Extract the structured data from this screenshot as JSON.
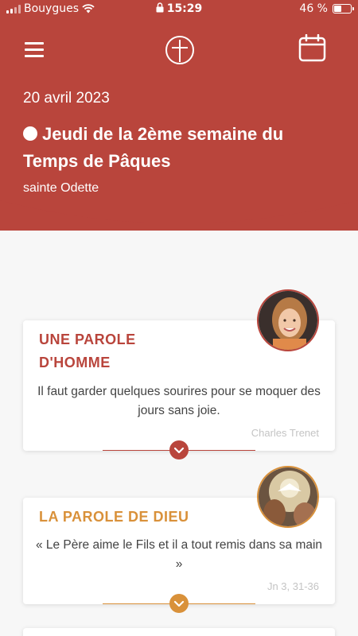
{
  "status_bar": {
    "carrier": "Bouygues",
    "time": "15:29",
    "battery": "46 %",
    "battery_level": 0.46
  },
  "header": {
    "date": "20 avril 2023",
    "title": "Jeudi de la 2ème semaine du Temps de Pâques",
    "saint": "sainte Odette",
    "color": "#b9453c"
  },
  "cards": [
    {
      "title": "UNE PAROLE D'HOMME",
      "text": "Il faut garder quelques sourires pour se moquer des jours sans joie.",
      "source": "Charles Trenet",
      "color": "#b9453c"
    },
    {
      "title": "LA PAROLE DE DIEU",
      "text": "« Le Père aime le Fils et il a tout remis dans sa main »",
      "source": "Jn 3, 31-36",
      "color": "#d9913a"
    }
  ],
  "icons": {
    "menu": "menu-icon",
    "logo": "cross-circle-icon",
    "calendar": "calendar-icon",
    "wifi": "wifi-icon",
    "lock": "lock-icon",
    "chevron": "chevron-down-icon"
  }
}
